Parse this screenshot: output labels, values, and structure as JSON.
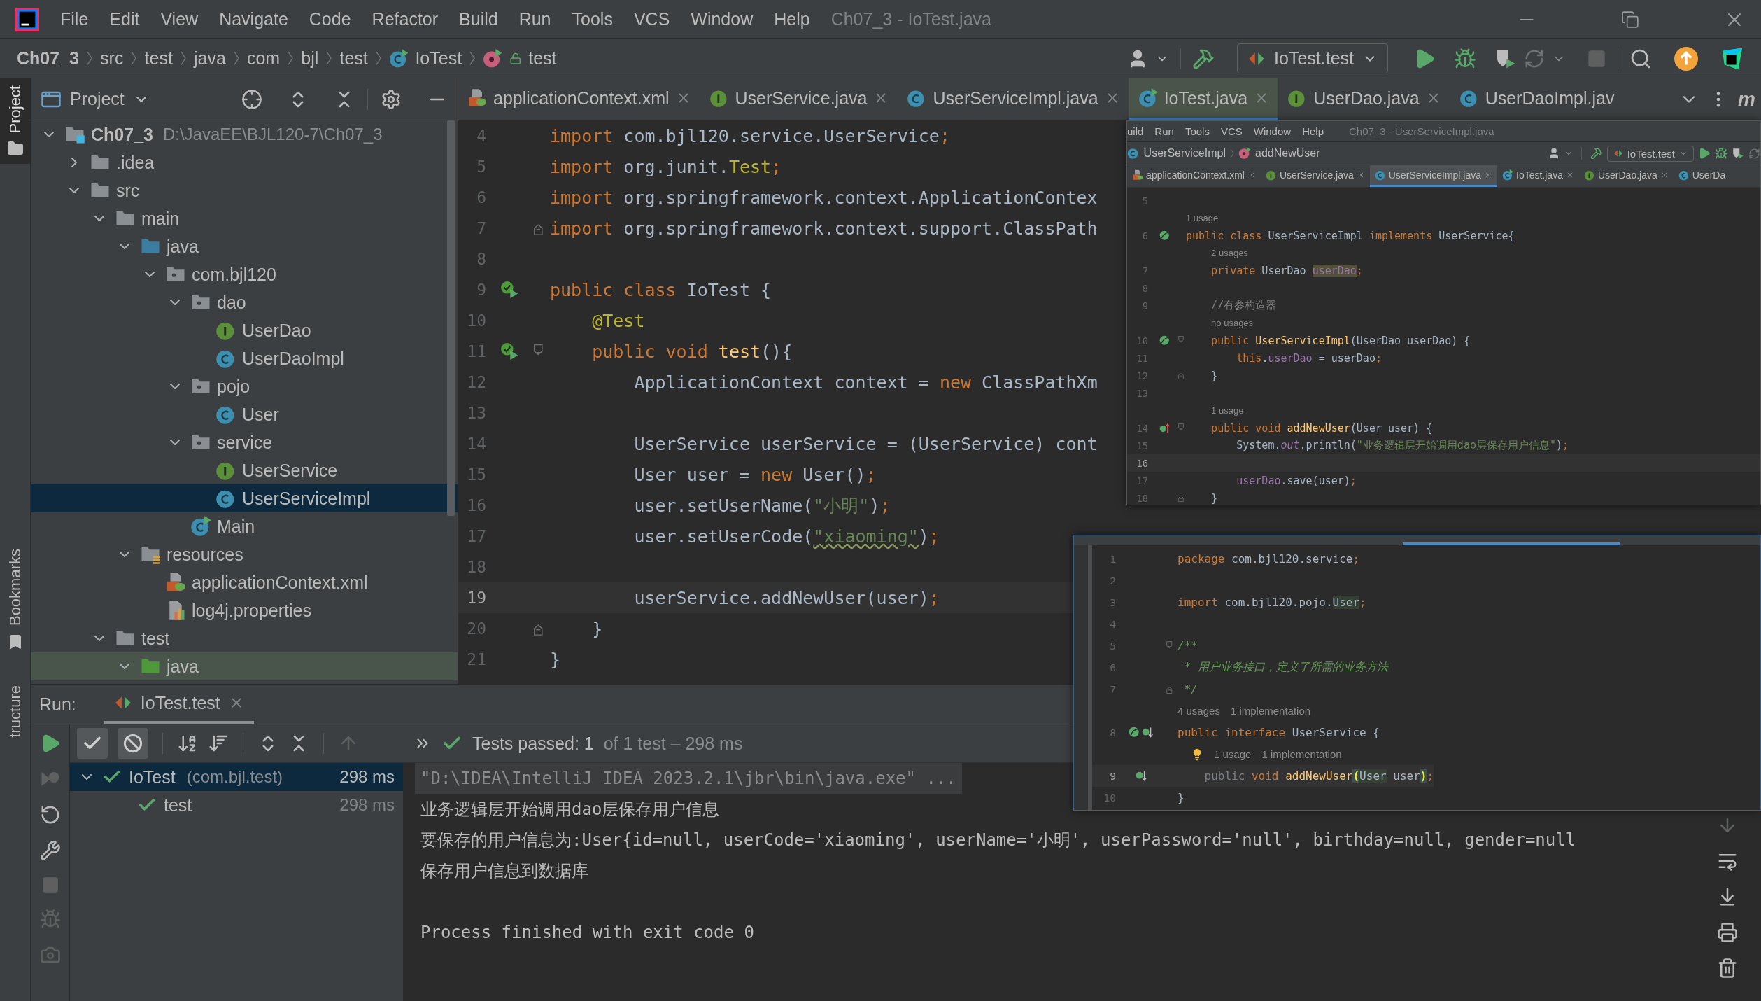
{
  "title_bar": {
    "menu": [
      "File",
      "Edit",
      "View",
      "Navigate",
      "Code",
      "Refactor",
      "Build",
      "Run",
      "Tools",
      "VCS",
      "Window",
      "Help"
    ],
    "title": "Ch07_3 - IoTest.java"
  },
  "breadcrumbs": [
    {
      "label": "Ch07_3",
      "kind": "project"
    },
    {
      "label": "src",
      "kind": "dir"
    },
    {
      "label": "test",
      "kind": "dir"
    },
    {
      "label": "java",
      "kind": "dir"
    },
    {
      "label": "com",
      "kind": "dir"
    },
    {
      "label": "bjl",
      "kind": "dir"
    },
    {
      "label": "test",
      "kind": "dir"
    },
    {
      "label": "IoTest",
      "kind": "test-class"
    },
    {
      "label": "test",
      "kind": "method"
    }
  ],
  "run_config": "IoTest.test",
  "side_tabs": [
    {
      "label": "Project",
      "selected": true,
      "kind": "project"
    },
    {
      "label": "Bookmarks",
      "selected": false,
      "kind": "bookmarks"
    },
    {
      "label": "tructure",
      "selected": false,
      "kind": "structure"
    }
  ],
  "project_panel": {
    "title": "Project",
    "tree": [
      {
        "label": "Ch07_3",
        "path": "D:\\JavaEE\\BJL120-7\\Ch07_3",
        "kind": "module",
        "expanded": true,
        "selected": false,
        "highlighted": false,
        "children": [
          {
            "label": ".idea",
            "kind": "folder",
            "expanded": false,
            "selected": false,
            "highlighted": false
          },
          {
            "label": "src",
            "kind": "folder",
            "expanded": true,
            "selected": false,
            "highlighted": false,
            "children": [
              {
                "label": "main",
                "kind": "folder",
                "expanded": true,
                "selected": false,
                "highlighted": false,
                "children": [
                  {
                    "label": "java",
                    "kind": "source-root",
                    "expanded": true,
                    "selected": false,
                    "highlighted": false,
                    "children": [
                      {
                        "label": "com.bjl120",
                        "kind": "package",
                        "expanded": true,
                        "selected": false,
                        "highlighted": false,
                        "children": [
                          {
                            "label": "dao",
                            "kind": "package",
                            "expanded": true,
                            "selected": false,
                            "highlighted": false,
                            "children": [
                              {
                                "label": "UserDao",
                                "kind": "interface",
                                "selected": false,
                                "highlighted": false
                              },
                              {
                                "label": "UserDaoImpl",
                                "kind": "class",
                                "selected": false,
                                "highlighted": false
                              }
                            ]
                          },
                          {
                            "label": "pojo",
                            "kind": "package",
                            "expanded": true,
                            "selected": false,
                            "highlighted": false,
                            "children": [
                              {
                                "label": "User",
                                "kind": "class",
                                "selected": false,
                                "highlighted": false
                              }
                            ]
                          },
                          {
                            "label": "service",
                            "kind": "package",
                            "expanded": true,
                            "selected": false,
                            "highlighted": false,
                            "children": [
                              {
                                "label": "UserService",
                                "kind": "interface",
                                "selected": false,
                                "highlighted": false
                              },
                              {
                                "label": "UserServiceImpl",
                                "kind": "class",
                                "selected": true,
                                "highlighted": false
                              }
                            ]
                          },
                          {
                            "label": "Main",
                            "kind": "runnable-class",
                            "selected": false,
                            "highlighted": false
                          }
                        ]
                      }
                    ]
                  },
                  {
                    "label": "resources",
                    "kind": "resources-root",
                    "expanded": true,
                    "selected": false,
                    "highlighted": false,
                    "children": [
                      {
                        "label": "applicationContext.xml",
                        "kind": "xml",
                        "selected": false,
                        "highlighted": false
                      },
                      {
                        "label": "log4j.properties",
                        "kind": "properties",
                        "selected": false,
                        "highlighted": false
                      }
                    ]
                  }
                ]
              },
              {
                "label": "test",
                "kind": "folder",
                "expanded": true,
                "selected": false,
                "highlighted": false,
                "children": [
                  {
                    "label": "java",
                    "kind": "test-root",
                    "expanded": true,
                    "selected": false,
                    "highlighted": true
                  }
                ]
              }
            ]
          }
        ]
      }
    ]
  },
  "editor": {
    "tabs": [
      {
        "label": "applicationContext.xml",
        "kind": "xml",
        "selected": false
      },
      {
        "label": "UserService.java",
        "kind": "interface",
        "selected": false
      },
      {
        "label": "UserServiceImpl.java",
        "kind": "class",
        "selected": false
      },
      {
        "label": "IoTest.java",
        "kind": "test-class",
        "selected": true
      },
      {
        "label": "UserDao.java",
        "kind": "interface",
        "selected": false
      },
      {
        "label": "UserDaoImpl.jav",
        "kind": "class",
        "selected": false
      }
    ],
    "right_tool_label": "m",
    "lines": [
      {
        "kind": "code",
        "number": "4",
        "current": false,
        "tokens": [
          {
            "kind": "keyword",
            "text": "import"
          },
          {
            "kind": "plain",
            "text": " com.bjl120.service.UserService"
          },
          {
            "kind": "punct",
            "text": ";"
          }
        ]
      },
      {
        "kind": "code",
        "number": "5",
        "current": false,
        "tokens": [
          {
            "kind": "keyword",
            "text": "import"
          },
          {
            "kind": "plain",
            "text": " org.junit."
          },
          {
            "kind": "annotation",
            "text": "Test"
          },
          {
            "kind": "punct",
            "text": ";"
          }
        ]
      },
      {
        "kind": "code",
        "number": "6",
        "current": false,
        "tokens": [
          {
            "kind": "keyword",
            "text": "import"
          },
          {
            "kind": "plain",
            "text": " org.springframework.context.ApplicationContex"
          }
        ]
      },
      {
        "kind": "code",
        "number": "7",
        "current": false,
        "gutter": [
          {
            "kind": "fold-end"
          }
        ],
        "tokens": [
          {
            "kind": "keyword",
            "text": "import"
          },
          {
            "kind": "plain",
            "text": " org.springframework.context.support.ClassPath"
          }
        ]
      },
      {
        "kind": "code",
        "number": "8",
        "current": false
      },
      {
        "kind": "code",
        "number": "9",
        "current": false,
        "gutter": [
          {
            "kind": "run"
          }
        ],
        "tokens": [
          {
            "kind": "keyword",
            "text": "public class"
          },
          {
            "kind": "plain",
            "text": " IoTest {"
          }
        ]
      },
      {
        "kind": "code",
        "number": "10",
        "current": false,
        "tokens": [
          {
            "kind": "annotation",
            "text": "    @Test"
          }
        ]
      },
      {
        "kind": "code",
        "number": "11",
        "current": false,
        "gutter": [
          {
            "kind": "run"
          },
          {
            "kind": "fold-start"
          }
        ],
        "tokens": [
          {
            "kind": "keyword",
            "text": "    public void"
          },
          {
            "kind": "method",
            "text": " test"
          },
          {
            "kind": "plain",
            "text": "(){"
          }
        ]
      },
      {
        "kind": "code",
        "number": "12",
        "current": false,
        "tokens": [
          {
            "kind": "plain",
            "text": "        ApplicationContext context = "
          },
          {
            "kind": "keyword",
            "text": "new"
          },
          {
            "kind": "plain",
            "text": " ClassPathXm"
          }
        ]
      },
      {
        "kind": "code",
        "number": "13",
        "current": false
      },
      {
        "kind": "code",
        "number": "14",
        "current": false,
        "tokens": [
          {
            "kind": "plain",
            "text": "        UserService userService = (UserService) cont"
          }
        ]
      },
      {
        "kind": "code",
        "number": "15",
        "current": false,
        "tokens": [
          {
            "kind": "plain",
            "text": "        User user = "
          },
          {
            "kind": "keyword",
            "text": "new"
          },
          {
            "kind": "plain",
            "text": " User()"
          },
          {
            "kind": "punct",
            "text": ";"
          }
        ]
      },
      {
        "kind": "code",
        "number": "16",
        "current": false,
        "tokens": [
          {
            "kind": "plain",
            "text": "        user.setUserName("
          },
          {
            "kind": "string",
            "text": "\"小明\""
          },
          {
            "kind": "plain",
            "text": ")"
          },
          {
            "kind": "punct",
            "text": ";"
          }
        ]
      },
      {
        "kind": "code",
        "number": "17",
        "current": false,
        "tokens": [
          {
            "kind": "plain",
            "text": "        user.setUserCode("
          },
          {
            "kind": "string-typo",
            "text": "\"xiaoming\""
          },
          {
            "kind": "plain",
            "text": ")"
          },
          {
            "kind": "punct",
            "text": ";"
          }
        ]
      },
      {
        "kind": "code",
        "number": "18",
        "current": false
      },
      {
        "kind": "code",
        "number": "19",
        "current": true,
        "tokens": [
          {
            "kind": "plain",
            "text": "        userService.addNewUser(user)"
          },
          {
            "kind": "punct",
            "text": ";"
          }
        ]
      },
      {
        "kind": "code",
        "number": "20",
        "current": false,
        "gutter": [
          {
            "kind": "fold-end"
          }
        ],
        "tokens": [
          {
            "kind": "plain",
            "text": "    }"
          }
        ]
      },
      {
        "kind": "code",
        "number": "21",
        "current": false,
        "tokens": [
          {
            "kind": "plain",
            "text": "}"
          }
        ]
      }
    ]
  },
  "run_panel": {
    "label": "Run:",
    "tab": "IoTest.test",
    "status": "Tests passed: 1",
    "status_detail": "of 1 test – 298 ms",
    "tests": [
      {
        "label": "IoTest",
        "detail": "(com.bjl.test)",
        "time": "298 ms",
        "expanded": true,
        "selected": true,
        "children": [
          {
            "label": "test",
            "time": "298 ms",
            "selected": false
          }
        ]
      }
    ],
    "console": [
      {
        "kind": "command",
        "text": "\"D:\\IDEA\\IntelliJ IDEA 2023.2.1\\jbr\\bin\\java.exe\" ..."
      },
      {
        "kind": "output",
        "text": "业务逻辑层开始调用dao层保存用户信息"
      },
      {
        "kind": "output",
        "text": "要保存的用户信息为:User{id=null, userCode='xiaoming', userName='小明', userPassword='null', birthday=null, gender=null"
      },
      {
        "kind": "output",
        "text": "保存用户信息到数据库"
      },
      {
        "kind": "exit",
        "text": "Process finished with exit code 0"
      }
    ]
  },
  "overlay_editor": {
    "menu": [
      "uild",
      "Run",
      "Tools",
      "VCS",
      "Window",
      "Help"
    ],
    "title": "Ch07_3 - UserServiceImpl.java",
    "breadcrumbs": [
      {
        "label": "UserServiceImpl",
        "kind": "class"
      },
      {
        "label": "addNewUser",
        "kind": "method"
      }
    ],
    "run_config": "IoTest.test",
    "tabs": [
      {
        "label": "applicationContext.xml",
        "kind": "xml",
        "selected": false
      },
      {
        "label": "UserService.java",
        "kind": "interface",
        "selected": false
      },
      {
        "label": "UserServiceImpl.java",
        "kind": "class",
        "selected": true
      },
      {
        "label": "IoTest.java",
        "kind": "test-class",
        "selected": false
      },
      {
        "label": "UserDao.java",
        "kind": "interface",
        "selected": false
      },
      {
        "label": "UserDa",
        "kind": "class",
        "selected": false
      }
    ],
    "lines": [
      {
        "kind": "code",
        "number": "5",
        "current": false
      },
      {
        "kind": "hint",
        "parts": [
          "1 usage"
        ]
      },
      {
        "kind": "code",
        "number": "6",
        "current": false,
        "gutter": [
          {
            "kind": "bean"
          }
        ],
        "tokens": [
          {
            "kind": "keyword",
            "text": "public class"
          },
          {
            "kind": "plain",
            "text": " UserServiceImpl "
          },
          {
            "kind": "keyword",
            "text": "implements"
          },
          {
            "kind": "plain",
            "text": " UserService{"
          }
        ]
      },
      {
        "kind": "hint",
        "parts": [
          "2 usages"
        ]
      },
      {
        "kind": "code",
        "number": "7",
        "current": false,
        "tokens": [
          {
            "kind": "keyword",
            "text": "    private"
          },
          {
            "kind": "plain",
            "text": " UserDao "
          },
          {
            "kind": "field-highlight",
            "text": "userDao"
          },
          {
            "kind": "punct",
            "text": ";"
          }
        ]
      },
      {
        "kind": "code",
        "number": "8",
        "current": false
      },
      {
        "kind": "code",
        "number": "9",
        "current": false,
        "tokens": [
          {
            "kind": "comment",
            "text": "    //有参构造器"
          }
        ]
      },
      {
        "kind": "hint",
        "parts": [
          "no usages"
        ]
      },
      {
        "kind": "code",
        "number": "10",
        "current": false,
        "gutter": [
          {
            "kind": "bean"
          },
          {
            "kind": "fold-start"
          }
        ],
        "tokens": [
          {
            "kind": "keyword",
            "text": "    public"
          },
          {
            "kind": "method",
            "text": " UserServiceImpl"
          },
          {
            "kind": "plain",
            "text": "(UserDao userDao) {"
          }
        ]
      },
      {
        "kind": "code",
        "number": "11",
        "current": false,
        "tokens": [
          {
            "kind": "keyword",
            "text": "        this"
          },
          {
            "kind": "plain",
            "text": "."
          },
          {
            "kind": "field",
            "text": "userDao"
          },
          {
            "kind": "plain",
            "text": " = userDao"
          },
          {
            "kind": "punct",
            "text": ";"
          }
        ]
      },
      {
        "kind": "code",
        "number": "12",
        "current": false,
        "gutter": [
          {
            "kind": "fold-end"
          }
        ],
        "tokens": [
          {
            "kind": "plain",
            "text": "    }"
          }
        ]
      },
      {
        "kind": "code",
        "number": "13",
        "current": false
      },
      {
        "kind": "hint",
        "parts": [
          "1 usage"
        ]
      },
      {
        "kind": "code",
        "number": "14",
        "current": false,
        "gutter": [
          {
            "kind": "implements"
          },
          {
            "kind": "fold-start"
          }
        ],
        "tokens": [
          {
            "kind": "keyword",
            "text": "    public void"
          },
          {
            "kind": "method",
            "text": " addNewUser"
          },
          {
            "kind": "plain",
            "text": "(User user) {"
          }
        ]
      },
      {
        "kind": "code",
        "number": "15",
        "current": false,
        "tokens": [
          {
            "kind": "plain",
            "text": "        System."
          },
          {
            "kind": "static",
            "text": "out"
          },
          {
            "kind": "plain",
            "text": ".println("
          },
          {
            "kind": "string",
            "text": "\"业务逻辑层开始调用dao层保存用户信息\""
          },
          {
            "kind": "plain",
            "text": ")"
          },
          {
            "kind": "punct",
            "text": ";"
          }
        ]
      },
      {
        "kind": "code",
        "number": "16",
        "current": true
      },
      {
        "kind": "code",
        "number": "17",
        "current": false,
        "tokens": [
          {
            "kind": "field",
            "text": "        userDao"
          },
          {
            "kind": "plain",
            "text": ".save(user)"
          },
          {
            "kind": "punct",
            "text": ";"
          }
        ]
      },
      {
        "kind": "code",
        "number": "18",
        "current": false,
        "gutter": [
          {
            "kind": "fold-end"
          }
        ],
        "tokens": [
          {
            "kind": "plain",
            "text": "    }"
          }
        ]
      }
    ]
  },
  "overlay_snippet": {
    "lines": [
      {
        "kind": "code",
        "number": "1",
        "current": false,
        "tokens": [
          {
            "kind": "keyword",
            "text": "package"
          },
          {
            "kind": "plain",
            "text": " com.bjl120.service"
          },
          {
            "kind": "punct",
            "text": ";"
          }
        ]
      },
      {
        "kind": "code",
        "number": "2",
        "current": false
      },
      {
        "kind": "code",
        "number": "3",
        "current": false,
        "tokens": [
          {
            "kind": "keyword",
            "text": "import"
          },
          {
            "kind": "plain",
            "text": " com.bjl120.pojo."
          },
          {
            "kind": "usage-highlight",
            "text": "User"
          },
          {
            "kind": "punct",
            "text": ";"
          }
        ]
      },
      {
        "kind": "code",
        "number": "4",
        "current": false
      },
      {
        "kind": "code",
        "number": "5",
        "current": false,
        "gutter": [
          {
            "kind": "fold-start"
          }
        ],
        "tokens": [
          {
            "kind": "doc",
            "text": "/**"
          }
        ]
      },
      {
        "kind": "code",
        "number": "6",
        "current": false,
        "tokens": [
          {
            "kind": "doc",
            "text": " * 用户业务接口，定义了所需的业务方法"
          }
        ]
      },
      {
        "kind": "code",
        "number": "7",
        "current": false,
        "gutter": [
          {
            "kind": "fold-end"
          }
        ],
        "tokens": [
          {
            "kind": "doc",
            "text": " */"
          }
        ]
      },
      {
        "kind": "hint",
        "parts": [
          "4 usages",
          "1 implementation"
        ]
      },
      {
        "kind": "code",
        "number": "8",
        "current": false,
        "gutter": [
          {
            "kind": "bean"
          },
          {
            "kind": "implemented"
          }
        ],
        "tokens": [
          {
            "kind": "keyword",
            "text": "public interface"
          },
          {
            "kind": "plain",
            "text": " UserService {"
          }
        ]
      },
      {
        "kind": "hint",
        "parts": [
          "1 usage",
          "1 implementation"
        ],
        "bulb": true
      },
      {
        "kind": "code",
        "number": "9",
        "current": true,
        "gutter": [
          {
            "kind": "implemented"
          }
        ],
        "tokens": [
          {
            "kind": "muted",
            "text": "    public"
          },
          {
            "kind": "keyword",
            "text": " void"
          },
          {
            "kind": "method",
            "text": " addNewUser"
          },
          {
            "kind": "bracket-match",
            "text": "("
          },
          {
            "kind": "usage-highlight",
            "text": "User"
          },
          {
            "kind": "plain",
            "text": " user"
          },
          {
            "kind": "bracket-match",
            "text": ")"
          },
          {
            "kind": "punct",
            "text": ";"
          }
        ]
      },
      {
        "kind": "code",
        "number": "10",
        "current": false,
        "tokens": [
          {
            "kind": "plain",
            "text": "}"
          }
        ]
      }
    ]
  }
}
